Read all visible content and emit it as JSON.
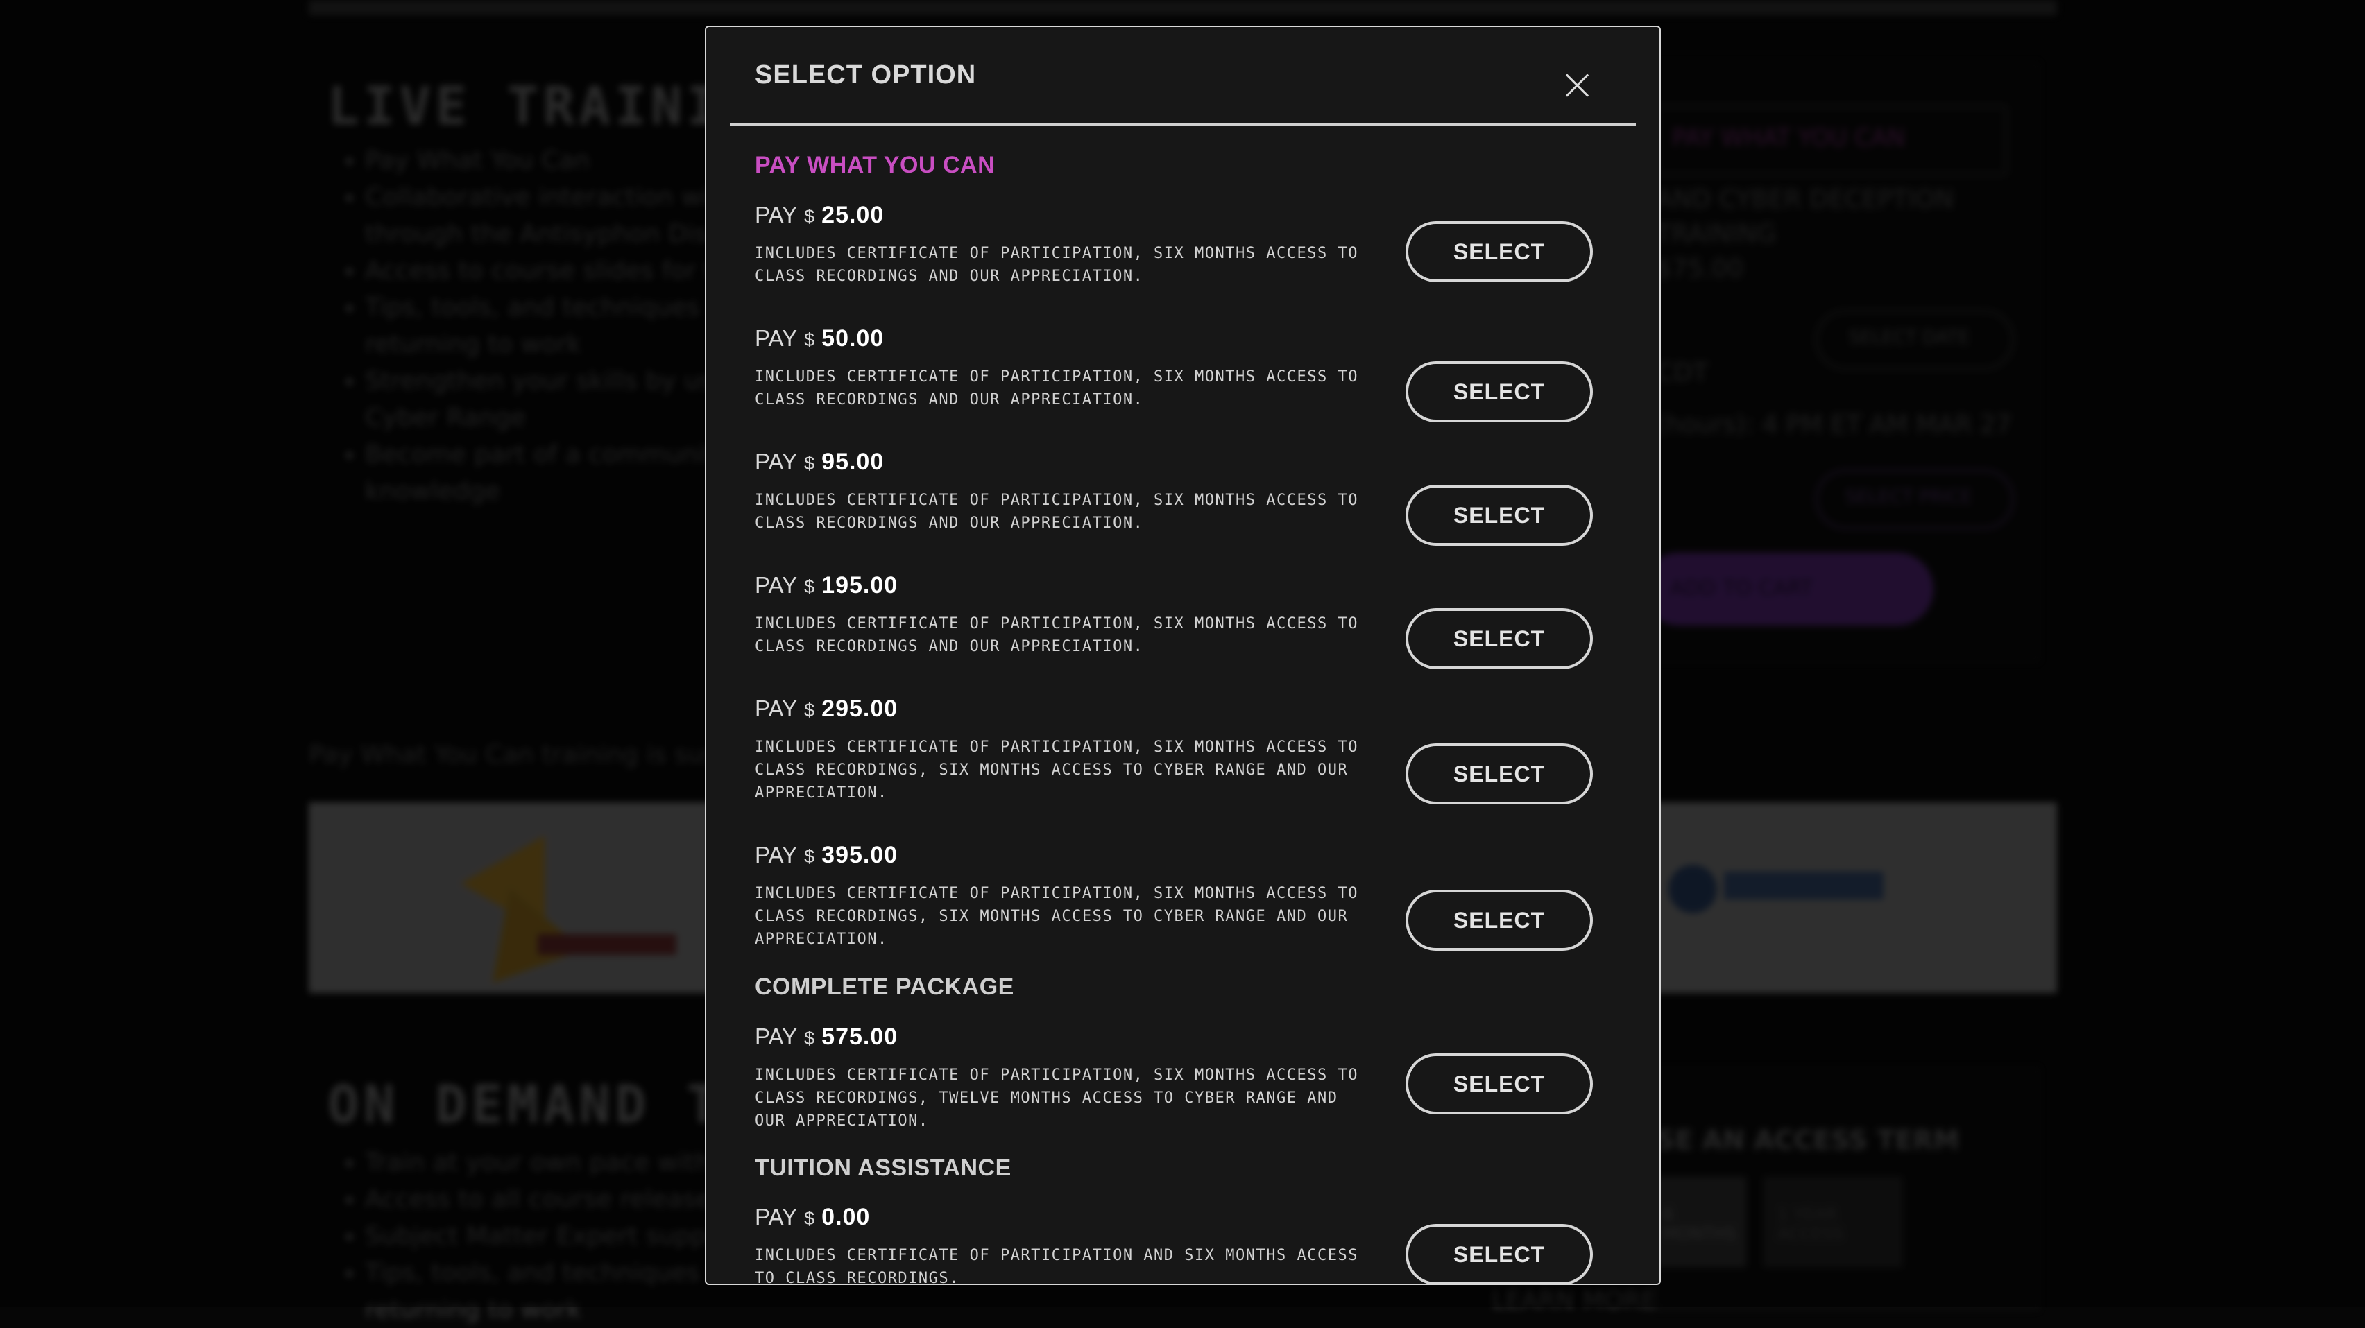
{
  "background": {
    "live_title": "LIVE TRAINING",
    "live_bullets": [
      "Pay What You Can",
      "Collaborative interaction with",
      "through the Antisyphon Disc",
      "Access to course slides for t",
      "Tips, tools, and techniques fr",
      "returning to work",
      "Strengthen your skills by us",
      "Cyber Range",
      "Become part of a communit",
      "knowledge"
    ],
    "pwyc_note": "Pay What You Can training is sust",
    "right_panel": {
      "select_label": "PAY WHAT YOU CAN",
      "event_line1": "AND CYBER DECEPTION",
      "event_line2": "TRAINING",
      "price": "$75.00",
      "select_date": "SELECT DATE",
      "time_line": "CDT",
      "duration_line": "(hours): 4 PM ET AM MAR 27",
      "select_price": "SELECT PRICE",
      "add_to_cart": "ADD TO CART"
    },
    "on_demand_title": "ON DEMAND TR",
    "on_demand_bullets": [
      "Train at your own pace with",
      "Access to all course release",
      "Subject Matter Expert suppo",
      "Tips, tools, and techniques f",
      "returning to work"
    ],
    "access_title": "SE AN ACCESS TERM",
    "access_options": [
      "6 MONTHS",
      "1 YEAR ACCESS"
    ],
    "footer_label": "LEARN MORE"
  },
  "modal": {
    "title": "SELECT OPTION",
    "close_label": "Close",
    "sections": [
      {
        "heading": "PAY WHAT YOU CAN",
        "options": [
          {
            "pay": "PAY",
            "currency": "$",
            "amount": "25.00",
            "description": "INCLUDES CERTIFICATE OF PARTICIPATION, SIX MONTHS ACCESS TO CLASS RECORDINGS AND OUR APPRECIATION.",
            "button": "SELECT"
          },
          {
            "pay": "PAY",
            "currency": "$",
            "amount": "50.00",
            "description": "INCLUDES CERTIFICATE OF PARTICIPATION, SIX MONTHS ACCESS TO CLASS RECORDINGS AND OUR APPRECIATION.",
            "button": "SELECT"
          },
          {
            "pay": "PAY",
            "currency": "$",
            "amount": "95.00",
            "description": "INCLUDES CERTIFICATE OF PARTICIPATION, SIX MONTHS ACCESS TO CLASS RECORDINGS AND OUR APPRECIATION.",
            "button": "SELECT"
          },
          {
            "pay": "PAY",
            "currency": "$",
            "amount": "195.00",
            "description": "INCLUDES CERTIFICATE OF PARTICIPATION, SIX MONTHS ACCESS TO CLASS RECORDINGS AND OUR APPRECIATION.",
            "button": "SELECT"
          },
          {
            "pay": "PAY",
            "currency": "$",
            "amount": "295.00",
            "description": "INCLUDES CERTIFICATE OF PARTICIPATION, SIX MONTHS ACCESS TO CLASS RECORDINGS, SIX MONTHS ACCESS TO CYBER RANGE AND OUR APPRECIATION.",
            "button": "SELECT"
          },
          {
            "pay": "PAY",
            "currency": "$",
            "amount": "395.00",
            "description": "INCLUDES CERTIFICATE OF PARTICIPATION, SIX MONTHS ACCESS TO CLASS RECORDINGS, SIX MONTHS ACCESS TO CYBER RANGE AND OUR APPRECIATION.",
            "button": "SELECT"
          }
        ]
      },
      {
        "heading": "COMPLETE PACKAGE",
        "options": [
          {
            "pay": "PAY",
            "currency": "$",
            "amount": "575.00",
            "description": "INCLUDES CERTIFICATE OF PARTICIPATION, SIX MONTHS ACCESS TO CLASS RECORDINGS, TWELVE MONTHS ACCESS TO CYBER RANGE AND OUR APPRECIATION.",
            "button": "SELECT"
          }
        ]
      },
      {
        "heading": "TUITION ASSISTANCE",
        "options": [
          {
            "pay": "PAY",
            "currency": "$",
            "amount": "0.00",
            "description": "INCLUDES CERTIFICATE OF PARTICIPATION AND SIX MONTHS ACCESS TO CLASS RECORDINGS.",
            "button": "SELECT"
          }
        ]
      }
    ]
  },
  "colors": {
    "accent_pink": "#c94ec2",
    "modal_bg": "#171717",
    "button_border": "#d6d6d6",
    "purple_cta": "#6a2d9a"
  }
}
